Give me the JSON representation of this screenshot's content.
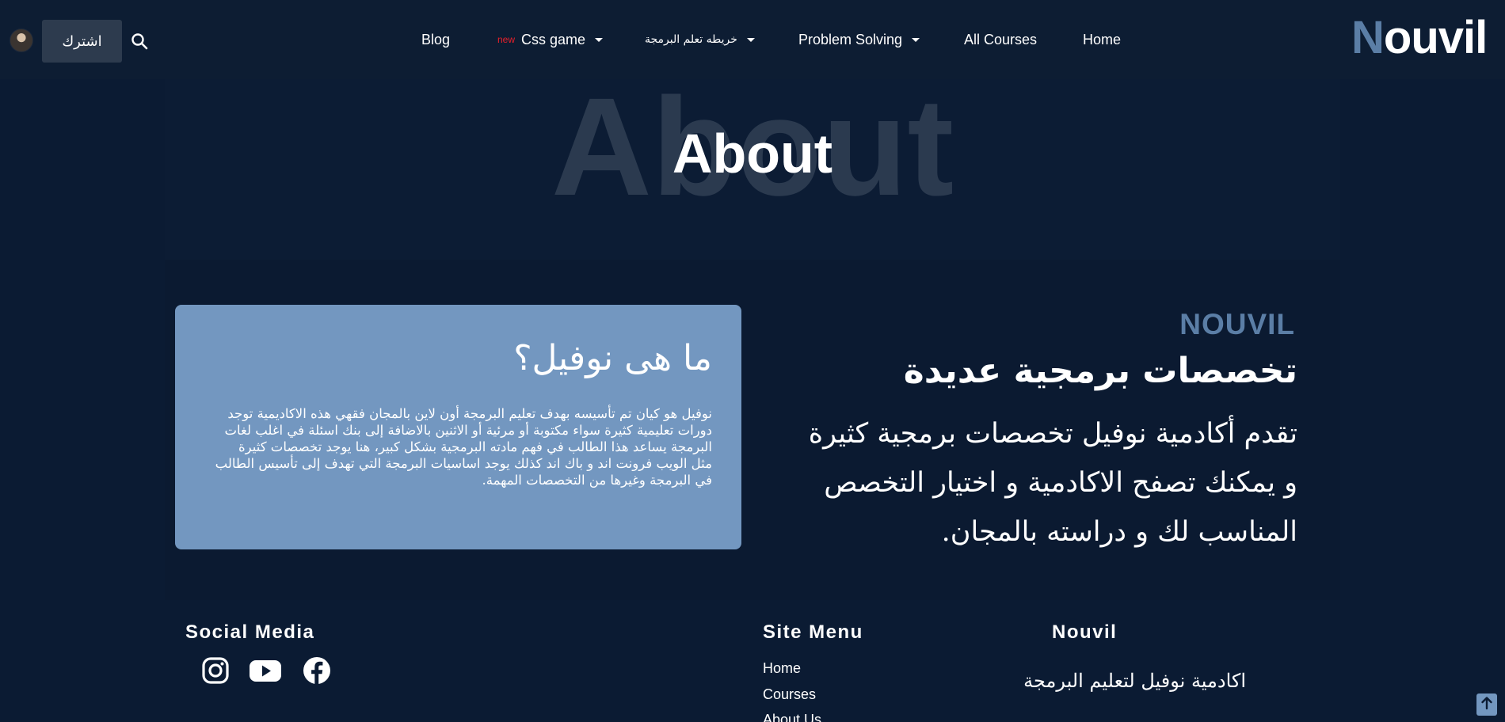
{
  "header": {
    "subscribe_label": "اشترك",
    "logo_first": "N",
    "logo_rest": "ouvil",
    "nav": {
      "blog": "Blog",
      "css_game_badge": "new",
      "css_game": "Css game",
      "roadmap": "خريطه تعلم البرمجة",
      "problem_solving": "Problem Solving",
      "all_courses": "All Courses",
      "home": "Home"
    }
  },
  "hero": {
    "background_text": "About",
    "title": "About"
  },
  "card": {
    "title": "ما هى نوفيل؟",
    "text": "نوفيل هو كيان تم تأسيسه بهدف تعليم البرمجة أون لاين بالمجان فقهي هذه الاكاديمية توجد دورات تعليمية كثيرة سواء مكتوبة أو مرئية أو الاثنين بالاضافة إلى بنك اسئلة في اغلب لغات البرمجة يساعد هذا الطالب في فهم مادته البرمجية بشكل كبير، هنا يوجد تخصصات كثيرة مثل الويب فرونت اند و باك اند كذلك يوجد اساسيات البرمجة التي تهدف إلى تأسيس الطالب في البرمجة وغيرها من التخصصات المهمة."
  },
  "about": {
    "brand": "NOUVIL",
    "heading": "تخصصات برمجية عديدة",
    "text": "تقدم أكادمية نوفيل تخصصات برمجية كثيرة و يمكنك تصفح الاكادمية و اختيار التخصص المناسب لك و دراسته بالمجان."
  },
  "footer": {
    "social_heading": "Social Media",
    "social_icons": [
      "instagram-icon",
      "youtube-icon",
      "facebook-icon"
    ],
    "site_menu_heading": "Site Menu",
    "site_menu": [
      "Home",
      "Courses",
      "About Us"
    ],
    "nouvil_heading": "Nouvil",
    "nouvil_desc": "اكادمية نوفيل لتعليم البرمجة"
  },
  "colors": {
    "background": "#0b1b33",
    "accent": "#5b7ea6",
    "card": "#7397c0",
    "new_badge": "#e8202a"
  }
}
